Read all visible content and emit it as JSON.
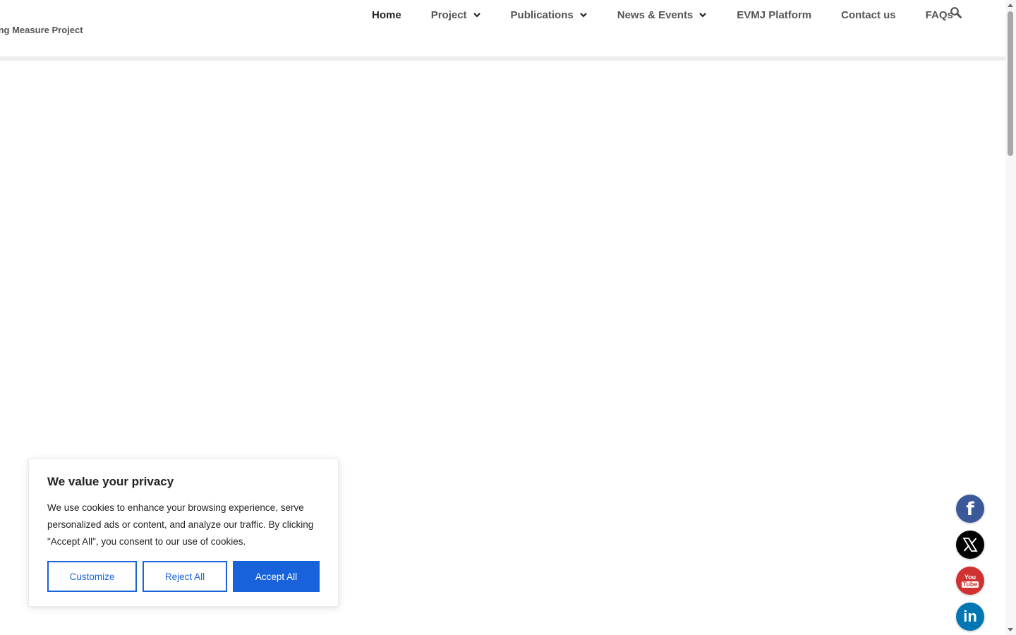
{
  "header": {
    "tagline": "ing Measure Project",
    "nav": [
      {
        "label": "Home",
        "dropdown": false,
        "active": true
      },
      {
        "label": "Project",
        "dropdown": true,
        "active": false
      },
      {
        "label": "Publications",
        "dropdown": true,
        "active": false
      },
      {
        "label": "News & Events",
        "dropdown": true,
        "active": false
      },
      {
        "label": "EVMJ Platform",
        "dropdown": false,
        "active": false
      },
      {
        "label": "Contact us",
        "dropdown": false,
        "active": false
      },
      {
        "label": "FAQs",
        "dropdown": false,
        "active": false
      }
    ],
    "search_icon": "search-icon"
  },
  "cookie_banner": {
    "title": "We value your privacy",
    "text": "We use cookies to enhance your browsing experience, serve personalized ads or content, and analyze our traffic. By clicking \"Accept All\", you consent to our use of cookies.",
    "customize_label": "Customize",
    "reject_label": "Reject All",
    "accept_label": "Accept All"
  },
  "social": {
    "facebook_icon": "facebook-icon",
    "x_icon": "x-icon",
    "youtube_icon": "youtube-icon",
    "linkedin_icon": "linkedin-icon",
    "facebook_letter": "f",
    "youtube_text_top": "You",
    "youtube_text_bottom": "Tube",
    "linkedin_text": "in"
  },
  "colors": {
    "accent": "#1863dc",
    "nav_text": "#555555",
    "nav_active": "#222222",
    "facebook": "#3b5998",
    "x": "#000000",
    "youtube": "#d03232",
    "linkedin": "#0077b5"
  }
}
